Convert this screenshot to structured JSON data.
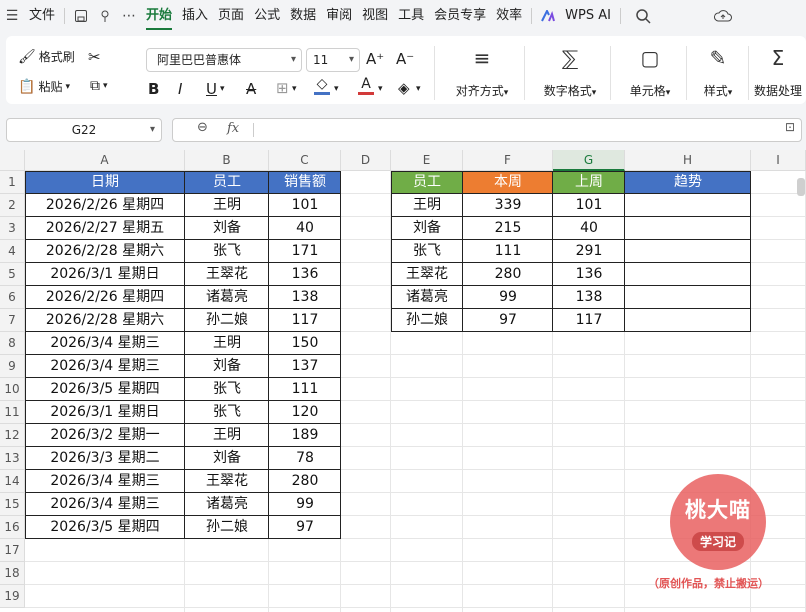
{
  "menu": {
    "file": "文件",
    "tabs": [
      "开始",
      "插入",
      "页面",
      "公式",
      "数据",
      "审阅",
      "视图",
      "工具",
      "会员专享",
      "效率"
    ],
    "active_tab": "开始",
    "wps_ai": "WPS AI"
  },
  "ribbon": {
    "format_painter": "格式刷",
    "paste": "粘贴",
    "font_name": "阿里巴巴普惠体",
    "font_size": "11",
    "align": "对齐方式",
    "number_format": "数字格式",
    "cell": "单元格",
    "style": "样式",
    "data_processing": "数据处理"
  },
  "formula_bar": {
    "name_box": "G22",
    "fx": "fx",
    "formula": ""
  },
  "sheet": {
    "columns": [
      "A",
      "B",
      "C",
      "D",
      "E",
      "F",
      "G",
      "H",
      "I"
    ],
    "selected_column": "G",
    "rows": [
      "1",
      "2",
      "3",
      "4",
      "5",
      "6",
      "7",
      "8",
      "9",
      "10",
      "11",
      "12",
      "13",
      "14",
      "15",
      "16",
      "17",
      "18",
      "19"
    ],
    "table1_headers": [
      "日期",
      "员工",
      "销售额"
    ],
    "table1_rows": [
      [
        "2026/2/26 星期四",
        "王明",
        "101"
      ],
      [
        "2026/2/27 星期五",
        "刘备",
        "40"
      ],
      [
        "2026/2/28 星期六",
        "张飞",
        "171"
      ],
      [
        "2026/3/1 星期日",
        "王翠花",
        "136"
      ],
      [
        "2026/2/26 星期四",
        "诸葛亮",
        "138"
      ],
      [
        "2026/2/28 星期六",
        "孙二娘",
        "117"
      ],
      [
        "2026/3/4 星期三",
        "王明",
        "150"
      ],
      [
        "2026/3/4 星期三",
        "刘备",
        "137"
      ],
      [
        "2026/3/5 星期四",
        "张飞",
        "111"
      ],
      [
        "2026/3/1 星期日",
        "张飞",
        "120"
      ],
      [
        "2026/3/2 星期一",
        "王明",
        "189"
      ],
      [
        "2026/3/3 星期二",
        "刘备",
        "78"
      ],
      [
        "2026/3/4 星期三",
        "王翠花",
        "280"
      ],
      [
        "2026/3/4 星期三",
        "诸葛亮",
        "99"
      ],
      [
        "2026/3/5 星期四",
        "孙二娘",
        "97"
      ]
    ],
    "table2_headers": [
      "员工",
      "本周",
      "上周",
      "趋势"
    ],
    "table2_rows": [
      [
        "王明",
        "339",
        "101",
        ""
      ],
      [
        "刘备",
        "215",
        "40",
        ""
      ],
      [
        "张飞",
        "111",
        "291",
        ""
      ],
      [
        "王翠花",
        "280",
        "136",
        ""
      ],
      [
        "诸葛亮",
        "99",
        "138",
        ""
      ],
      [
        "孙二娘",
        "97",
        "117",
        ""
      ]
    ]
  },
  "watermark": {
    "title": "桃大喵",
    "subtitle": "学习记",
    "note": "（原创作品，禁止搬运）"
  },
  "colors": {
    "accent": "#1a7a3c",
    "header_blue": "#4472c4",
    "header_green": "#70ad47",
    "header_orange": "#ed7d31",
    "watermark": "#e85a5a"
  }
}
